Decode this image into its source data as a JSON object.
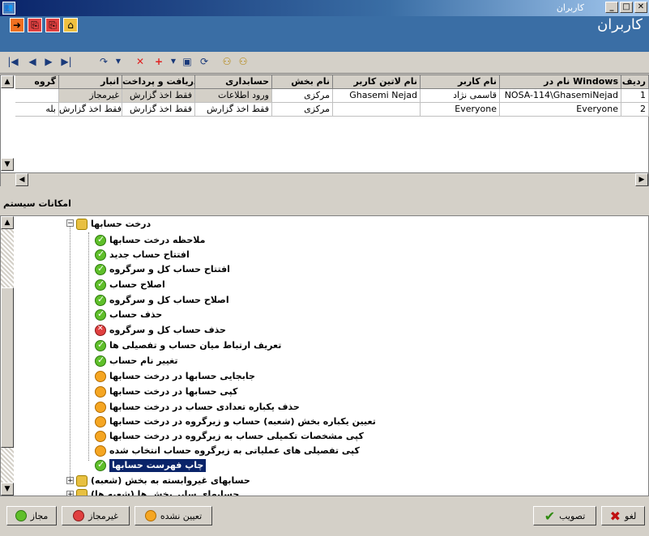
{
  "window": {
    "title": "کاربران"
  },
  "form": {
    "title": "کاربران"
  },
  "toolbar1": {
    "buttons": [
      "exit-icon",
      "copy-icon",
      "paste-icon",
      "home-icon"
    ]
  },
  "toolbar2": {
    "nav": [
      "|◀",
      "◀",
      "▶",
      "▶|"
    ],
    "actions": [
      "refresh-icon",
      "delete-icon",
      "add-icon",
      "save-icon",
      "reload-icon",
      "users-icon",
      "users-icon"
    ]
  },
  "grid": {
    "columns": [
      "ردیف",
      "نام در Windows",
      "نام کاربر",
      "نام لاتین کاربر",
      "نام بخش",
      "حسابداری",
      "دریافت و پرداخت",
      "انبار",
      "گروه"
    ],
    "rows": [
      [
        "1",
        "NOSA-114\\GhasemiNejad",
        "قاسمی نژاد",
        "Ghasemi Nejad",
        "مرکزی",
        "ورود اطلاعات",
        "فقط اخذ گزارش",
        "غیرمجاز",
        ""
      ],
      [
        "2",
        "Everyone",
        "Everyone",
        "",
        "مرکزی",
        "فقط اخذ گزارش",
        "فقط اخذ گزارش",
        "فقط اخذ گزارش",
        "بله"
      ]
    ]
  },
  "section": {
    "label": "امکانات سیستم"
  },
  "tree": {
    "root": "درخت حسابها",
    "children": [
      {
        "label": "ملاحظه درخت حسابها",
        "status": "ok"
      },
      {
        "label": "افتتاح حساب جدید",
        "status": "ok"
      },
      {
        "label": "افتتاح حساب کل و سرگروه",
        "status": "ok"
      },
      {
        "label": "اصلاح حساب",
        "status": "ok"
      },
      {
        "label": "اصلاح حساب کل و سرگروه",
        "status": "ok"
      },
      {
        "label": "حذف حساب",
        "status": "ok"
      },
      {
        "label": "حذف حساب کل و سرگروه",
        "status": "no"
      },
      {
        "label": "تعریف ارتباط میان حساب و تفصیلی ها",
        "status": "ok"
      },
      {
        "label": "تغییر نام حساب",
        "status": "ok"
      },
      {
        "label": "جابجایی حسابها در درخت حسابها",
        "status": "un"
      },
      {
        "label": "کپی حسابها در درخت حسابها",
        "status": "un"
      },
      {
        "label": "حذف یکباره تعدادی حساب در درخت حسابها",
        "status": "un"
      },
      {
        "label": "تعیین یکباره بخش (شعبه) حساب و زیرگروه در درخت حسابها",
        "status": "un"
      },
      {
        "label": "کپی مشخصات تکمیلی حساب به زیرگروه در درخت حسابها",
        "status": "un"
      },
      {
        "label": "کپی تفصیلی های عملیاتی به زیرگروه حساب انتخاب شده",
        "status": "un"
      },
      {
        "label": "چاپ فهرست حسابها",
        "status": "ok",
        "selected": true
      }
    ],
    "siblings": [
      {
        "label": "حسابهای غیروابسته به بخش (شعبه)"
      },
      {
        "label": "حسابهای سایر بخش ها (شعبه ها)"
      }
    ]
  },
  "bottom": {
    "allowed": "مجاز",
    "denied": "غیرمجاز",
    "unset": "تعیین نشده",
    "approve": "تصویب",
    "cancel": "لغو"
  },
  "colors": {
    "ok": "#5fbf2a",
    "no": "#e04040",
    "un": "#f5a623",
    "titlebar": "#0a246a",
    "toolbar": "#3a6ea5"
  }
}
